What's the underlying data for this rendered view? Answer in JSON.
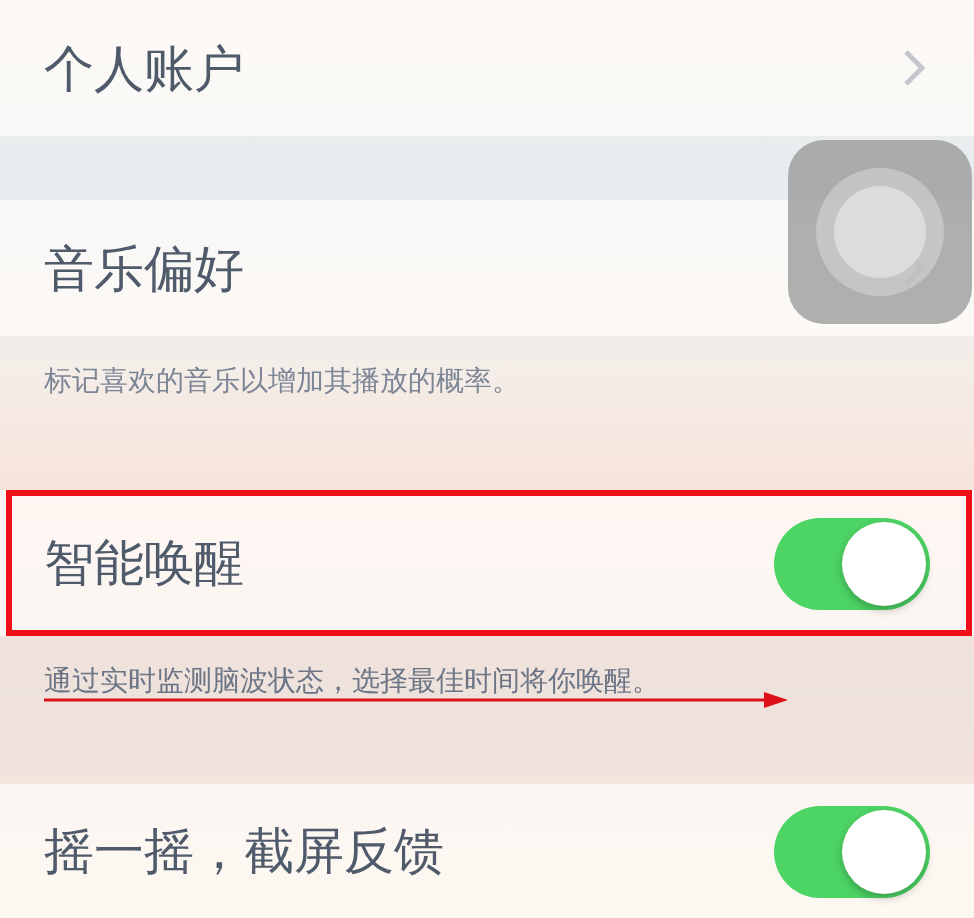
{
  "sections": [
    {
      "rows": [
        {
          "kind": "link",
          "label": "个人账户"
        }
      ]
    },
    {
      "rows": [
        {
          "kind": "link",
          "label": "音乐偏好"
        }
      ],
      "footer": {
        "text": "标记喜欢的音乐以增加其播放的概率。",
        "annotated": false
      }
    },
    {
      "rows": [
        {
          "kind": "toggle",
          "label": "智能唤醒",
          "on": true,
          "highlighted": true
        }
      ],
      "footer": {
        "text": "通过实时监测脑波状态，选择最佳时间将你唤醒。",
        "annotated": true
      }
    },
    {
      "rows": [
        {
          "kind": "toggle",
          "label": "摇一摇，截屏反馈",
          "on": true,
          "highlighted": false
        }
      ]
    }
  ],
  "assistive_touch": {
    "visible": true
  }
}
